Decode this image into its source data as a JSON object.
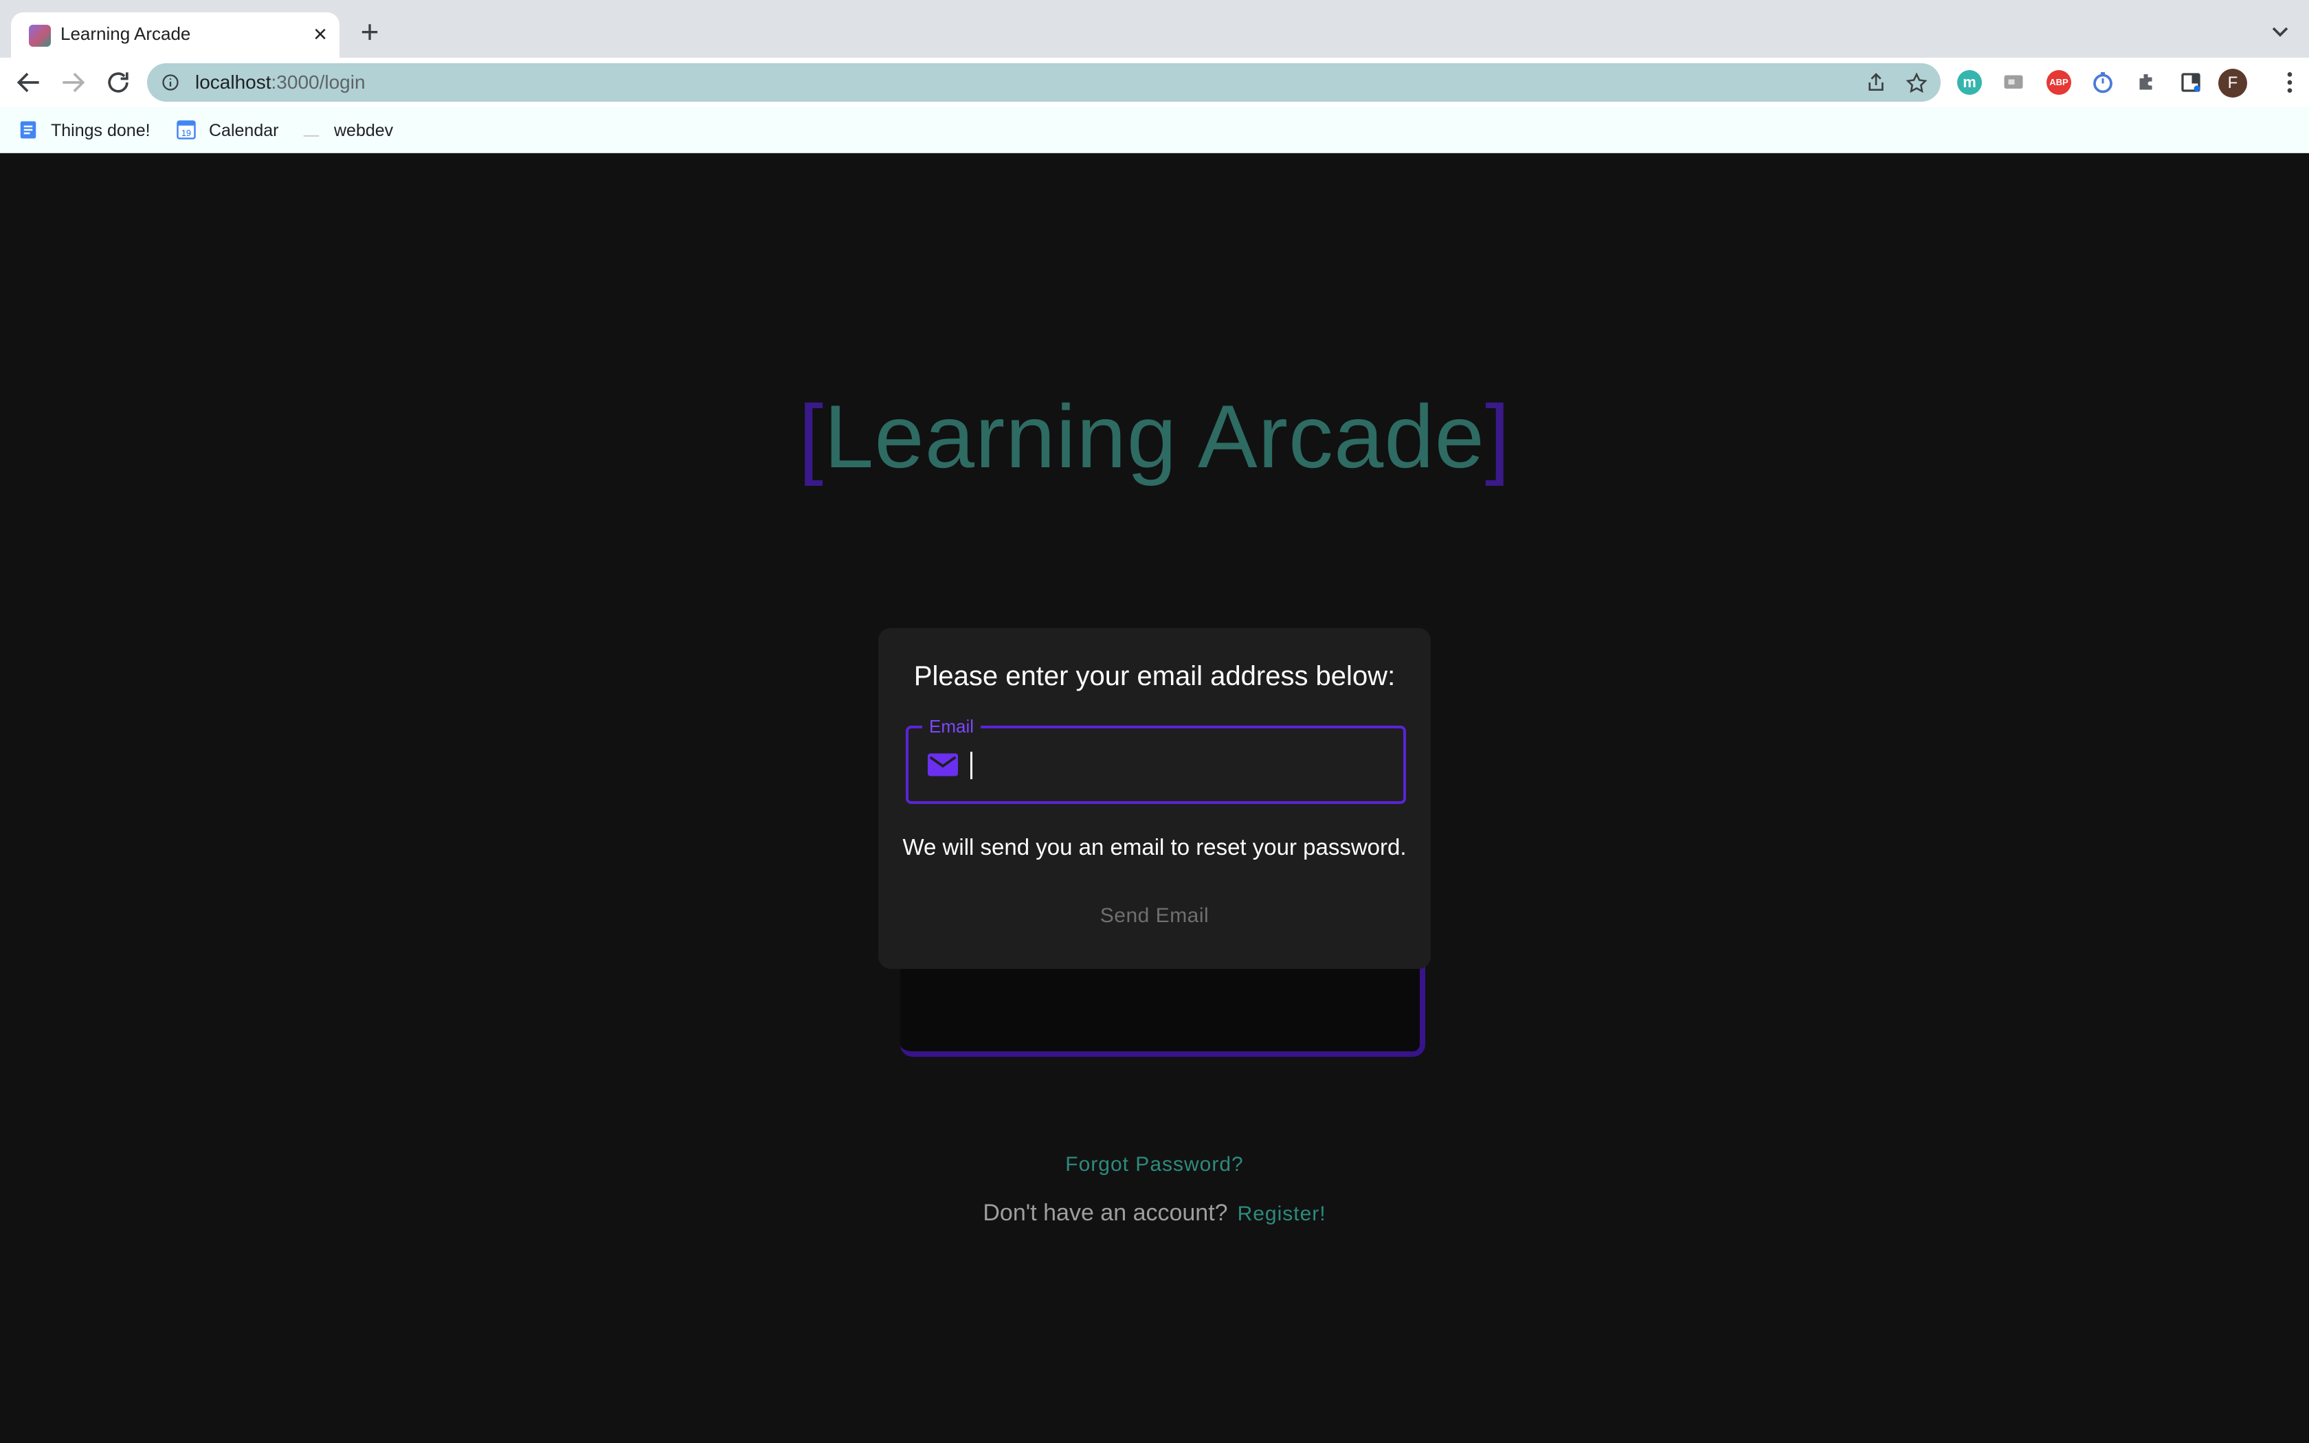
{
  "browser": {
    "tab": {
      "title": "Learning Arcade"
    },
    "address_bar": {
      "host": "localhost",
      "path": ":3000/login"
    },
    "bookmarks": [
      {
        "label": "Things done!",
        "icon": "docs-icon"
      },
      {
        "label": "Calendar",
        "icon": "calendar-icon",
        "icon_text": "19"
      },
      {
        "label": "webdev",
        "icon": "folder-icon"
      }
    ],
    "profile_initial": "F",
    "extensions": [
      {
        "name": "m-extension-icon",
        "text": "m"
      },
      {
        "name": "screenshot-extension-icon"
      },
      {
        "name": "adblock-plus-icon",
        "text": "ABP"
      },
      {
        "name": "timer-extension-icon"
      },
      {
        "name": "puzzle-icon"
      },
      {
        "name": "reading-list-icon"
      }
    ]
  },
  "page": {
    "logo": {
      "open_bracket": "[",
      "text": "Learning Arcade",
      "close_bracket": "]"
    },
    "reset_card": {
      "heading": "Please enter your email address below:",
      "email_label": "Email",
      "email_value": "",
      "info": "We will send you an email to reset your password.",
      "send_button": "Send Email"
    },
    "forgot_password_link": "Forgot Password?",
    "register_prompt": "Don't have an account?",
    "register_link": "Register!"
  },
  "colors": {
    "background": "#111111",
    "card": "#1e1e1e",
    "accent_purple": "#5a24d6",
    "logo_teal": "#2e6b63",
    "link_teal": "#2e8a7e"
  }
}
